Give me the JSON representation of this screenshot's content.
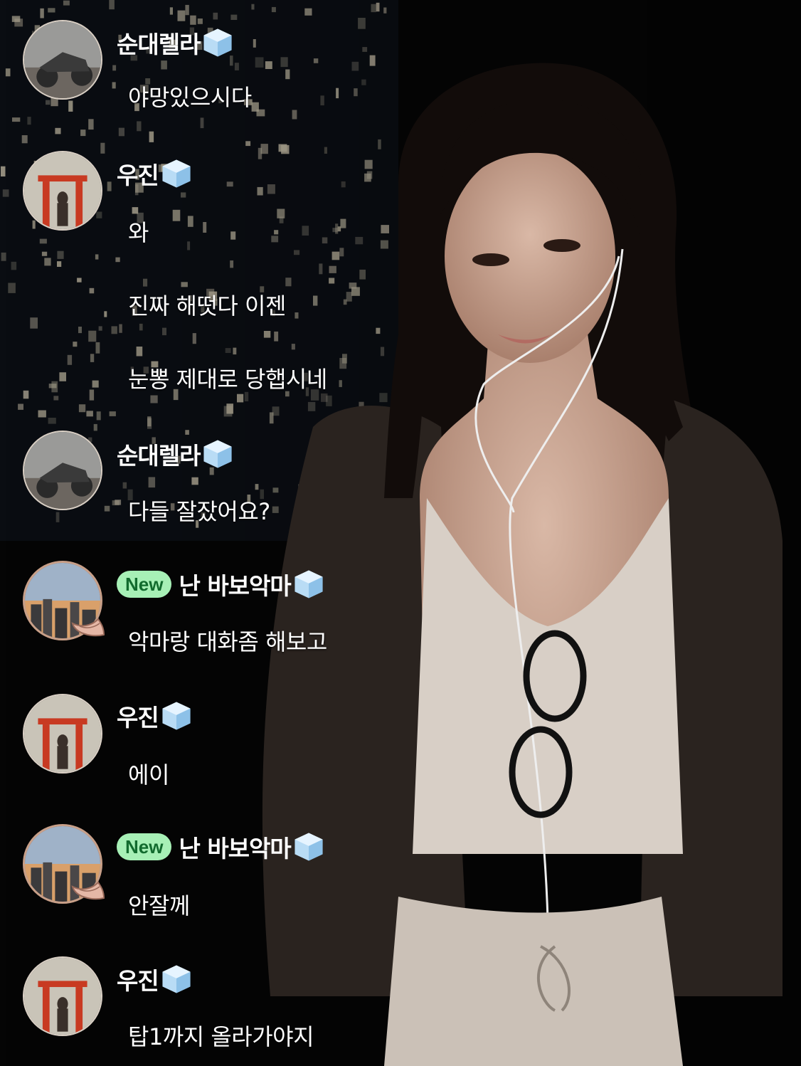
{
  "chat": {
    "users": {
      "a": {
        "name": "순대렐라",
        "avatar": "motorcycle-avatar",
        "new_badge": "",
        "badge_icon": "ice-cube-icon"
      },
      "b": {
        "name": "우진",
        "avatar": "torii-gate-avatar",
        "new_badge": "",
        "badge_icon": "ice-cube-icon"
      },
      "c": {
        "name": "난 바보악마",
        "avatar": "city-sunset-avatar",
        "new_badge": "New",
        "badge_icon": "ice-cube-icon",
        "decoration": "wing-icon"
      }
    },
    "messages": [
      {
        "text": "야망있으시다"
      },
      {
        "text": "와"
      },
      {
        "text": "진짜 해떳다 이젠"
      },
      {
        "text": "눈뽕 제대로 당햅시네"
      },
      {
        "text": "다들 잘잤어요?"
      },
      {
        "text": "악마랑 대화좀 해보고"
      },
      {
        "text": "에이"
      },
      {
        "text": "안잘께"
      },
      {
        "text": "탑1까지 올라가야지"
      }
    ]
  },
  "colors": {
    "background": "#000000",
    "new_badge_bg": "#a7f0b6",
    "new_badge_text": "#126b2e",
    "text": "#ffffff"
  }
}
